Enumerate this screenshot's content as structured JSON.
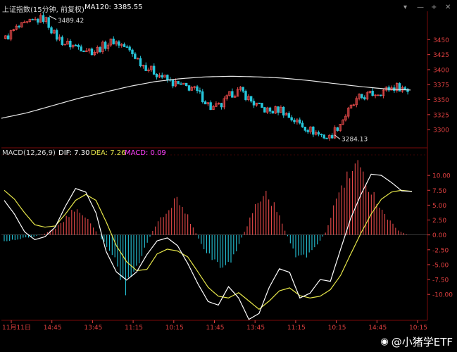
{
  "header": {
    "instrument": "上证指数(15分钟, 前复权)",
    "ma_label": "MA120: 3385.55"
  },
  "macd_header": {
    "title": "MACD(12,26,9)",
    "dif": "DIF: 7.30",
    "dea": "DEA: 7.26",
    "macd": "MACD: 0.09"
  },
  "watermark": "@小猪学ETF",
  "colors": {
    "up": "#e84a4a",
    "down": "#26c6da",
    "ma": "#e8e8e8",
    "dif": "#ffffff",
    "dea": "#e7e74a",
    "grid": "#7a0a0a",
    "axis_text": "#e04040"
  },
  "chart_data": [
    {
      "type": "candlestick",
      "title": "上证指数(15分钟, 前复权)",
      "ylim": [
        3272,
        3495
      ],
      "y_ticks": [
        3300,
        3325,
        3350,
        3375,
        3400,
        3425,
        3450
      ],
      "x_tick_labels": [
        "11月11日",
        "14:45",
        "13:45",
        "11:15",
        "10:15",
        "11:45",
        "13:45",
        "11:15",
        "10:15",
        "14:45",
        "10:15"
      ],
      "annotations": [
        {
          "text": "3489.42",
          "value": 3489.42
        },
        {
          "text": "3284.13",
          "value": 3284.13
        }
      ],
      "ma120_close": 3385.55,
      "ma120_path": [
        3319,
        3328,
        3340,
        3352,
        3362,
        3372,
        3380,
        3385,
        3388,
        3389,
        3388,
        3386,
        3382,
        3377,
        3372,
        3368,
        3366
      ],
      "close_path": [
        3452,
        3468,
        3474,
        3482,
        3486,
        3458,
        3444,
        3440,
        3436,
        3430,
        3440,
        3448,
        3440,
        3426,
        3408,
        3398,
        3388,
        3378,
        3372,
        3370,
        3355,
        3335,
        3340,
        3360,
        3365,
        3348,
        3336,
        3330,
        3335,
        3320,
        3310,
        3300,
        3292,
        3286,
        3308,
        3332,
        3352,
        3358,
        3362,
        3368,
        3372,
        3366
      ]
    },
    {
      "type": "macd",
      "title": "MACD(12,26,9)",
      "ylim": [
        -14,
        12.5
      ],
      "y_ticks": [
        10.0,
        7.5,
        5.0,
        2.5,
        0.0,
        -2.5,
        -5.0,
        -7.5,
        -10.0
      ],
      "series": [
        {
          "name": "DIF",
          "values": [
            5.8,
            3.5,
            0.5,
            -0.8,
            -0.3,
            1.3,
            4.8,
            7.8,
            7.2,
            3.7,
            -2.8,
            -6.2,
            -7.6,
            -6.2,
            -3.3,
            -1.0,
            -0.5,
            -1.8,
            -4.8,
            -8.2,
            -11.2,
            -11.8,
            -8.7,
            -10.6,
            -14.2,
            -13.2,
            -8.8,
            -5.7,
            -6.3,
            -10.6,
            -9.8,
            -7.5,
            -7.8,
            -2.4,
            2.8,
            6.8,
            10.2,
            10.0,
            8.8,
            7.4,
            7.3
          ]
        },
        {
          "name": "DEA",
          "values": [
            7.5,
            6.0,
            3.7,
            1.7,
            1.3,
            1.5,
            3.5,
            5.8,
            6.8,
            5.8,
            2.2,
            -1.8,
            -4.5,
            -6.0,
            -5.8,
            -3.2,
            -2.4,
            -2.7,
            -3.7,
            -6.2,
            -8.8,
            -10.3,
            -10.6,
            -9.7,
            -11.1,
            -12.5,
            -11.1,
            -9.4,
            -8.9,
            -10.2,
            -10.6,
            -10.3,
            -9.2,
            -6.8,
            -3.2,
            0.3,
            3.5,
            6.0,
            7.2,
            7.5,
            7.3
          ]
        },
        {
          "name": "MACD",
          "values": [
            -1.0,
            -0.8,
            -0.5,
            -0.3,
            0.2,
            1.0,
            2.5,
            4.5,
            3.2,
            1.0,
            -1.5,
            -4.0,
            -9.5,
            -6.0,
            -2.0,
            1.5,
            3.5,
            6.3,
            4.0,
            0.5,
            -3.0,
            -4.5,
            -6.0,
            -3.0,
            1.0,
            5.0,
            7.0,
            4.5,
            0.5,
            -3.5,
            -3.5,
            -1.8,
            0.5,
            6.0,
            9.2,
            11.5,
            9.0,
            6.0,
            3.0,
            1.0,
            0.09
          ]
        }
      ]
    }
  ]
}
